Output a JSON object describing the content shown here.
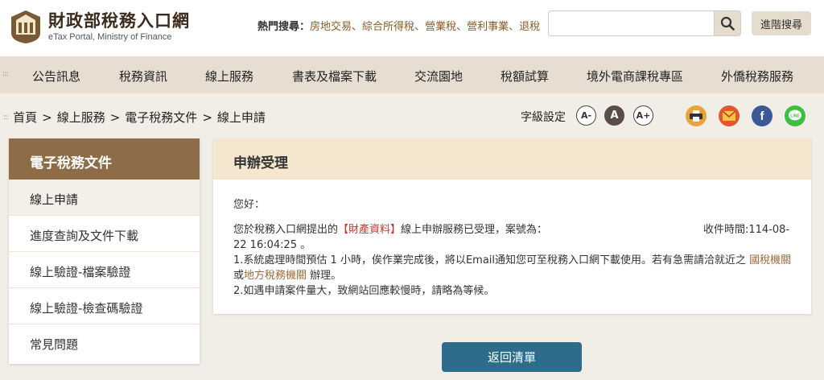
{
  "header": {
    "logo_cn": "財政部稅務入口網",
    "logo_en": "eTax Portal, Ministry of Finance",
    "hot_label": "熱門搜尋：",
    "hot_links": [
      "房地交易",
      "綜合所得稅",
      "營業稅",
      "營利事業",
      "退稅"
    ],
    "hot_separator": "、",
    "search_placeholder": "",
    "search_icon": "search-icon",
    "advanced_search": "進階搜尋"
  },
  "nav": {
    "items": [
      "公告訊息",
      "稅務資訊",
      "線上服務",
      "書表及檔案下載",
      "交流園地",
      "稅額試算",
      "境外電商課稅專區",
      "外僑稅務服務"
    ]
  },
  "breadcrumb": {
    "items": [
      "首頁",
      "線上服務",
      "電子稅務文件",
      "線上申請"
    ],
    "separator": ">"
  },
  "font_size": {
    "label": "字級設定",
    "small": "A-",
    "medium": "A",
    "large": "A+"
  },
  "share": [
    "print-icon",
    "email-icon",
    "facebook-icon",
    "line-icon"
  ],
  "sidebar": {
    "title": "電子稅務文件",
    "items": [
      "線上申請",
      "進度查詢及文件下載",
      "線上驗證-檔案驗證",
      "線上驗證-檢查碼驗證",
      "常見問題"
    ],
    "active_index": 0
  },
  "panel": {
    "title": "申辦受理",
    "greeting": "您好：",
    "line1_a": "您於稅務入口網提出的",
    "line1_highlight": "【財產資料】",
    "line1_b": "線上申辦服務已受理，案號為：",
    "received_time": "收件時間:114-08-",
    "line2": "22 16:04:25 。",
    "line3_a": "1.系統處理時間預估 1 小時，俟作業完成後，將以Email通知您可至稅務入口網下載使用。若有急需請洽就近之",
    "line3_link": "國稅機關",
    "line4_a": "或",
    "line4_link": "地方稅務機關",
    "line4_b": "辦理。",
    "line5": "2.如遇申請案件量大，致網站回應較慢時，請略為等候。"
  },
  "back_button": "返回清單",
  "colors": {
    "nav_bg": "#e7ddd0",
    "sidebar_title": "#8d6c47",
    "panel_head": "#f5e6cf",
    "back_button": "#2e6c8b",
    "highlight_red": "#c0392b",
    "link_brown": "#9a6a35"
  }
}
